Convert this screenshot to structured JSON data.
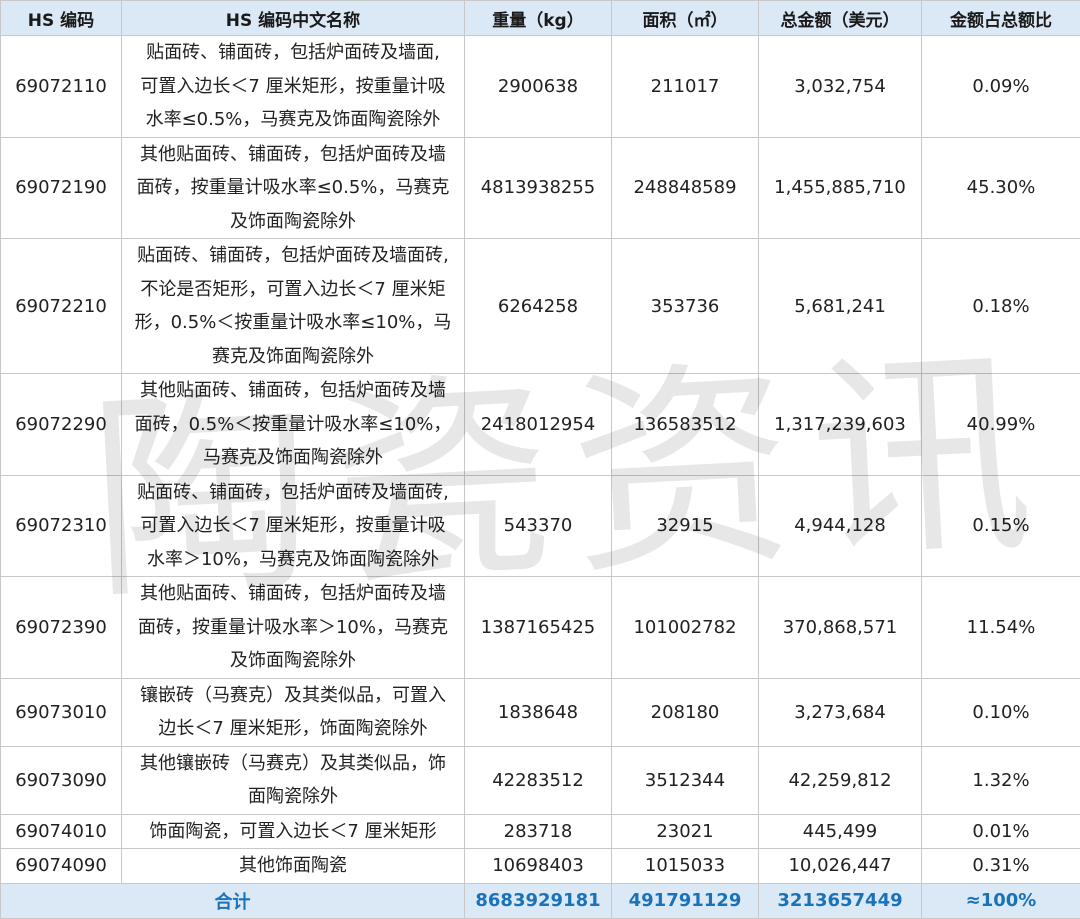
{
  "table": {
    "headers": [
      "HS 编码",
      "HS 编码中文名称",
      "重量（kg）",
      "面积（㎡）",
      "总金额（美元）",
      "金额占总额比"
    ],
    "rows": [
      {
        "code": "69072110",
        "name_lines": [
          "贴面砖、铺面砖，包括炉面砖及墙面,",
          "可置入边长＜7 厘米矩形，按重量计吸",
          "水率≤0.5%，马赛克及饰面陶瓷除外"
        ],
        "weight": "2900638",
        "area": "211017",
        "amount": "3,032,754",
        "share": "0.09%"
      },
      {
        "code": "69072190",
        "name_lines": [
          "其他贴面砖、铺面砖，包括炉面砖及墙",
          "面砖，按重量计吸水率≤0.5%，马赛克",
          "及饰面陶瓷除外"
        ],
        "weight": "4813938255",
        "area": "248848589",
        "amount": "1,455,885,710",
        "share": "45.30%"
      },
      {
        "code": "69072210",
        "name_lines": [
          "贴面砖、铺面砖，包括炉面砖及墙面砖,",
          "不论是否矩形，可置入边长＜7 厘米矩",
          "形，0.5%＜按重量计吸水率≤10%，马",
          "赛克及饰面陶瓷除外"
        ],
        "weight": "6264258",
        "area": "353736",
        "amount": "5,681,241",
        "share": "0.18%"
      },
      {
        "code": "69072290",
        "name_lines": [
          "其他贴面砖、铺面砖，包括炉面砖及墙",
          "面砖，0.5%＜按重量计吸水率≤10%，",
          "马赛克及饰面陶瓷除外"
        ],
        "weight": "2418012954",
        "area": "136583512",
        "amount": "1,317,239,603",
        "share": "40.99%"
      },
      {
        "code": "69072310",
        "name_lines": [
          "贴面砖、铺面砖，包括炉面砖及墙面砖,",
          "可置入边长＜7 厘米矩形，按重量计吸",
          "水率＞10%，马赛克及饰面陶瓷除外"
        ],
        "weight": "543370",
        "area": "32915",
        "amount": "4,944,128",
        "share": "0.15%"
      },
      {
        "code": "69072390",
        "name_lines": [
          "其他贴面砖、铺面砖，包括炉面砖及墙",
          "面砖，按重量计吸水率＞10%，马赛克",
          "及饰面陶瓷除外"
        ],
        "weight": "1387165425",
        "area": "101002782",
        "amount": "370,868,571",
        "share": "11.54%"
      },
      {
        "code": "69073010",
        "name_lines": [
          "镶嵌砖（马赛克）及其类似品，可置入",
          "边长＜7 厘米矩形，饰面陶瓷除外"
        ],
        "weight": "1838648",
        "area": "208180",
        "amount": "3,273,684",
        "share": "0.10%"
      },
      {
        "code": "69073090",
        "name_lines": [
          "其他镶嵌砖（马赛克）及其类似品，饰",
          "面陶瓷除外"
        ],
        "weight": "42283512",
        "area": "3512344",
        "amount": "42,259,812",
        "share": "1.32%"
      },
      {
        "code": "69074010",
        "name_lines": [
          "饰面陶瓷，可置入边长＜7 厘米矩形"
        ],
        "weight": "283718",
        "area": "23021",
        "amount": "445,499",
        "share": "0.01%"
      },
      {
        "code": "69074090",
        "name_lines": [
          "其他饰面陶瓷"
        ],
        "weight": "10698403",
        "area": "1015033",
        "amount": "10,026,447",
        "share": "0.31%"
      }
    ],
    "total": {
      "label": "合计",
      "weight": "8683929181",
      "area": "491791129",
      "amount": "3213657449",
      "share": "≈100%"
    }
  },
  "watermark": {
    "text": "陶瓷资讯"
  },
  "colors": {
    "header_bg": "#dbe9f6",
    "total_text": "#1a73b8",
    "grid": "#c8c8c8"
  }
}
